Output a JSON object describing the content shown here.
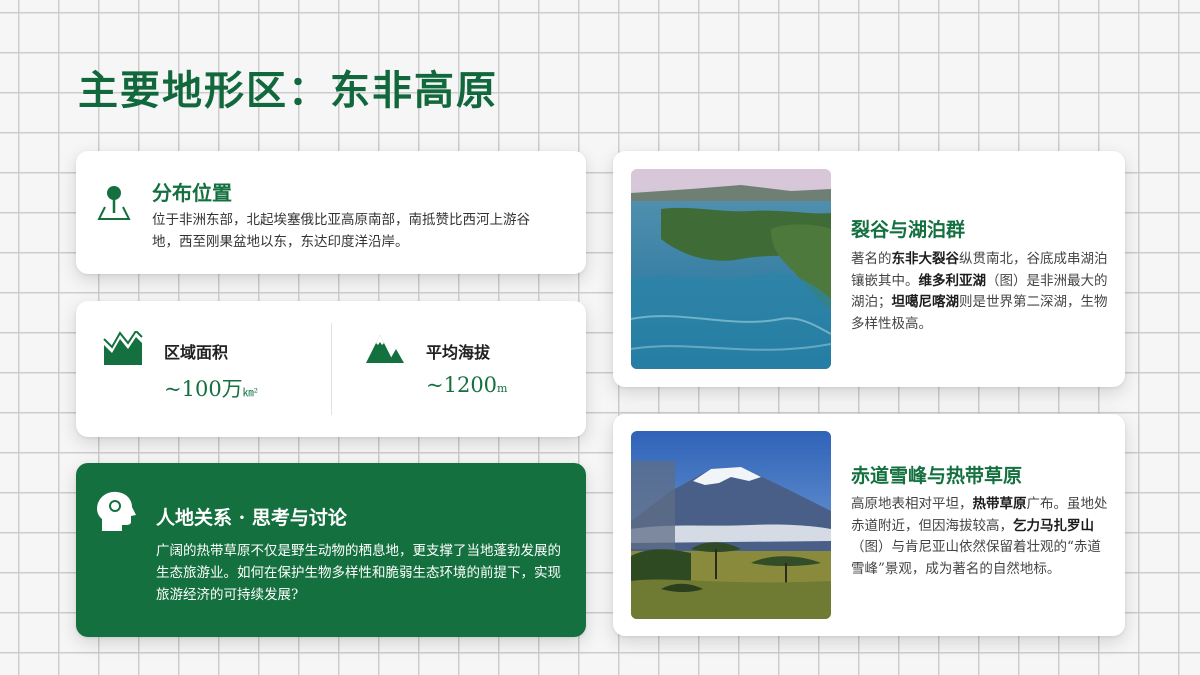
{
  "page": {
    "title": "主要地形区：东非高原"
  },
  "location": {
    "title": "分布位置",
    "text": "位于非洲东部，北起埃塞俄比亚高原南部，南抵赞比西河上游谷地，西至刚果盆地以东，东达印度洋沿岸。",
    "icon": "map-pin-icon"
  },
  "stats": {
    "area": {
      "label": "区域面积",
      "value": "~100万",
      "unit": "㎞²",
      "icon": "area-chart-icon"
    },
    "altitude": {
      "label": "平均海拔",
      "value": "~1200",
      "unit": "m",
      "icon": "mountain-icon"
    }
  },
  "discussion": {
    "title": "人地关系 · 思考与讨论",
    "text": "广阔的热带草原不仅是野生动物的栖息地，更支撑了当地蓬勃发展的生态旅游业。如何在保护生物多样性和脆弱生态环境的前提下，实现旅游经济的可持续发展?",
    "icon": "head-profile-icon"
  },
  "rift": {
    "title": "裂谷与湖泊群",
    "text": {
      "t1": "著名的",
      "h1": "东非大裂谷",
      "t2": "纵贯南北，谷底成串湖泊镶嵌其中。",
      "h2": "维多利亚湖",
      "t3": "（图）是非洲最大的湖泊；",
      "h3": "坦噶尼喀湖",
      "t4": "则是世界第二深湖，生物多样性极高。"
    }
  },
  "equator": {
    "title": "赤道雪峰与热带草原",
    "text": {
      "t1": "高原地表相对平坦，",
      "h1": "热带草原",
      "t2": "广布。虽地处赤道附近，但因海拔较高，",
      "h2": "乞力马扎罗山",
      "t3": "（图）与肯尼亚山依然保留着壮观的“赤道雪峰”景观，成为著名的自然地标。"
    }
  },
  "colors": {
    "primary": "#14703f",
    "title": "#11683c",
    "grid": "#cdcdcd"
  }
}
